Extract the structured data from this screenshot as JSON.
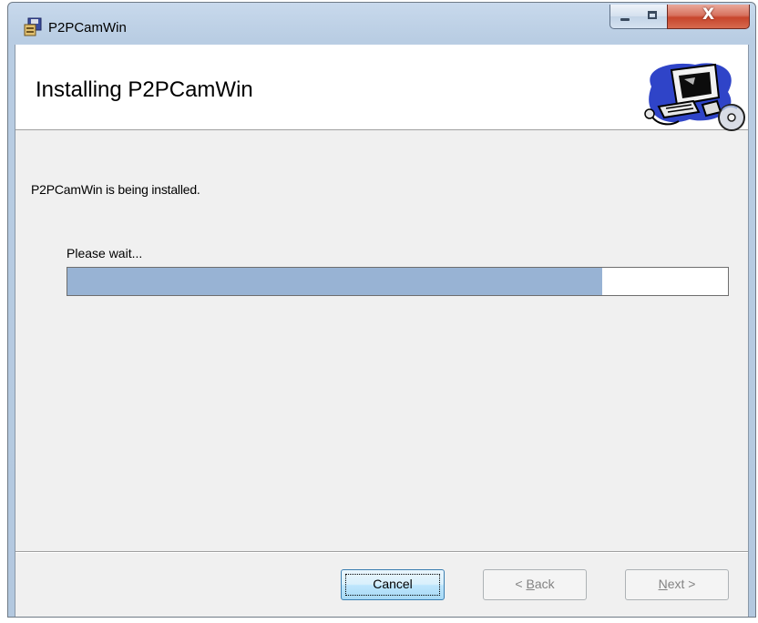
{
  "window": {
    "title": "P2PCamWin",
    "caption_buttons": {
      "minimize_icon": "minimize-icon",
      "maximize_icon": "maximize-icon",
      "close_icon": "close-icon",
      "close_glyph": "X"
    }
  },
  "banner": {
    "title": "Installing P2PCamWin",
    "art_icon": "computer-clipart-icon"
  },
  "body": {
    "status": "P2PCamWin is being installed.",
    "wait_label": "Please wait...",
    "progress_percent": 81
  },
  "buttons": {
    "cancel": "Cancel",
    "back": "< Back",
    "back_accel": "B",
    "next": "Next >",
    "next_accel": "N"
  },
  "colors": {
    "progress_fill": "#98b3d4",
    "window_frame": "#b9cde3",
    "close_button": "#c7452c"
  }
}
